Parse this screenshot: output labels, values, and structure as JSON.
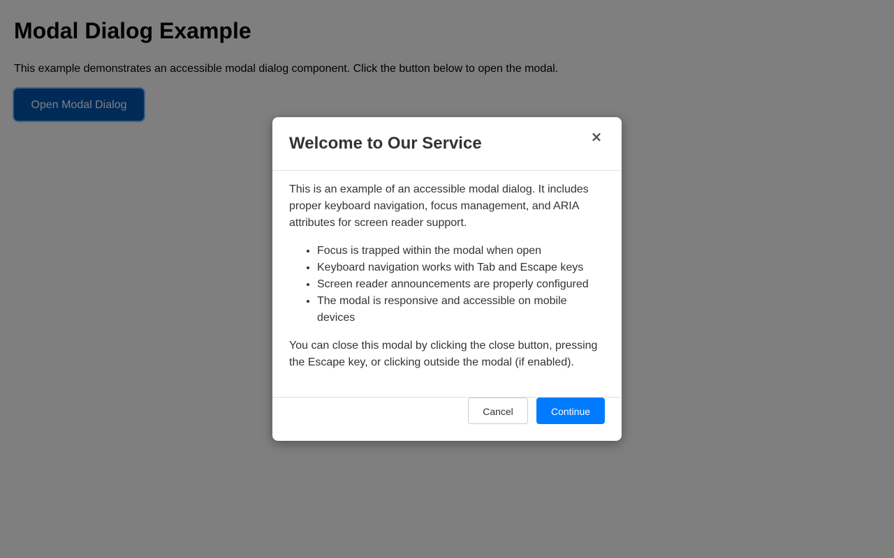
{
  "page": {
    "title": "Modal Dialog Example",
    "description": "This example demonstrates an accessible modal dialog component. Click the button below to open the modal.",
    "open_button_label": "Open Modal Dialog"
  },
  "modal": {
    "title": "Welcome to Our Service",
    "close_label": "×",
    "intro": "This is an example of an accessible modal dialog. It includes proper keyboard navigation, focus management, and ARIA attributes for screen reader support.",
    "features": [
      "Focus is trapped within the modal when open",
      "Keyboard navigation works with Tab and Escape keys",
      "Screen reader announcements are properly configured",
      "The modal is responsive and accessible on mobile devices"
    ],
    "outro": "You can close this modal by clicking the close button, pressing the Escape key, or clicking outside the modal (if enabled).",
    "cancel_label": "Cancel",
    "continue_label": "Continue"
  },
  "colors": {
    "primary": "#007bff",
    "primary_dark": "#0056b3",
    "overlay": "rgba(0,0,0,0.5)",
    "text": "#333333"
  },
  "icons": {
    "close": "close-icon"
  }
}
